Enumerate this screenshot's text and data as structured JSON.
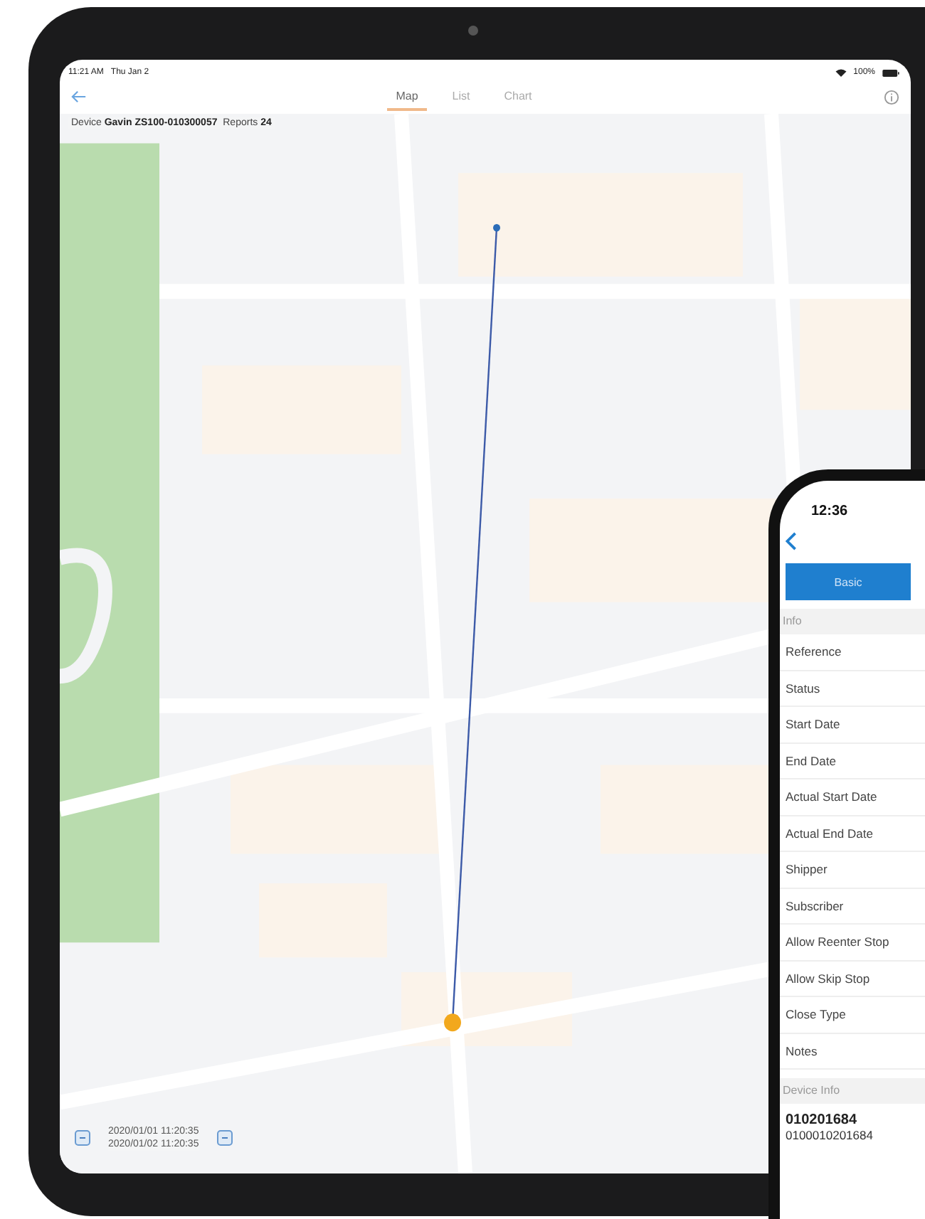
{
  "tablet": {
    "status_bar": {
      "time": "11:21 AM",
      "date": "Thu Jan 2",
      "battery": "100%"
    },
    "tabs": [
      {
        "label": "Map",
        "selected": true
      },
      {
        "label": "List",
        "selected": false
      },
      {
        "label": "Chart",
        "selected": false
      }
    ],
    "device_info": {
      "device_label": "Device",
      "device_name": "Gavin ZS100-010300057",
      "reports_label": "Reports",
      "reports_count": "24"
    },
    "time_range": {
      "start": "2020/01/01 11:20:35",
      "end": "2020/01/02 11:20:35"
    }
  },
  "phone": {
    "time": "12:36",
    "segments": [
      {
        "label": "Basic",
        "selected": true
      }
    ],
    "sections": [
      {
        "title": "Info",
        "rows": [
          "Reference",
          "Status",
          "Start Date",
          "End Date",
          "Actual Start Date",
          "Actual End Date",
          "Shipper",
          "Subscriber",
          "Allow Reenter Stop",
          "Allow Skip Stop",
          "Close Type",
          "Notes"
        ]
      },
      {
        "title": "Device Info"
      }
    ],
    "device": {
      "name": "010201684",
      "serial": "0100010201684"
    }
  }
}
